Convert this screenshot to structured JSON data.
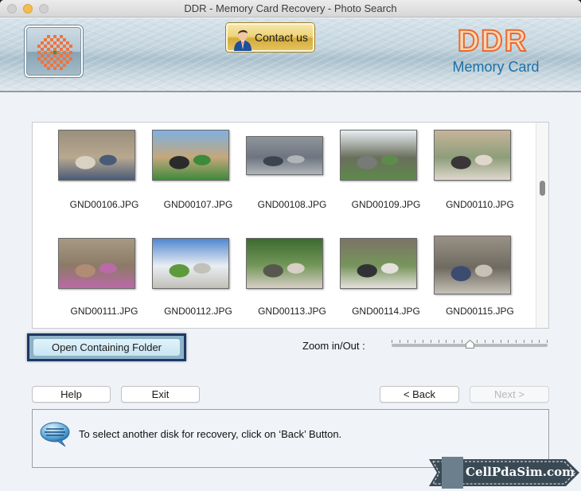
{
  "window": {
    "title": "DDR - Memory Card Recovery - Photo Search"
  },
  "header": {
    "logo_icon": "ddr-checker-logo-icon",
    "contact_label": "Contact us",
    "contact_icon": "person-icon",
    "brand_title": "DDR",
    "brand_subtitle": "Memory Card"
  },
  "gallery": {
    "items": [
      {
        "name": "GND00106.JPG",
        "colors": [
          "#9a8f7c",
          "#b8a88f",
          "#4a5b78",
          "#d9d2c2"
        ]
      },
      {
        "name": "GND00107.JPG",
        "colors": [
          "#7fb0e0",
          "#c5a77a",
          "#3d8a3b",
          "#2b2b2b"
        ]
      },
      {
        "name": "GND00108.JPG",
        "colors": [
          "#8f959b",
          "#6f7580",
          "#b0b5ba",
          "#3c4450"
        ]
      },
      {
        "name": "GND00109.JPG",
        "colors": [
          "#e8eef3",
          "#6a6e5c",
          "#5e8a4b",
          "#787a78"
        ]
      },
      {
        "name": "GND00110.JPG",
        "colors": [
          "#c6b49a",
          "#8d9e7a",
          "#e0d7cc",
          "#3a3536"
        ]
      },
      {
        "name": "GND00111.JPG",
        "colors": [
          "#a69a84",
          "#8c7a66",
          "#bb6aa8",
          "#b18c75"
        ]
      },
      {
        "name": "GND00112.JPG",
        "colors": [
          "#4f86d0",
          "#e9eef3",
          "#c2c0b8",
          "#5c9a3c"
        ]
      },
      {
        "name": "GND00113.JPG",
        "colors": [
          "#3c6a30",
          "#75985a",
          "#d8cfc6",
          "#58574f"
        ]
      },
      {
        "name": "GND00114.JPG",
        "colors": [
          "#7b7466",
          "#76955b",
          "#e4e1dc",
          "#303236"
        ]
      },
      {
        "name": "GND00115.JPG",
        "colors": [
          "#9a9186",
          "#6e6a60",
          "#c7c2b8",
          "#3b4c70"
        ]
      }
    ],
    "scroll_position": 0.4
  },
  "actions": {
    "open_folder_label": "Open Containing Folder",
    "zoom_label": "Zoom in/Out :",
    "zoom_value": 0.5,
    "zoom_ticks": 21,
    "help_label": "Help",
    "exit_label": "Exit",
    "back_label": "< Back",
    "next_label": "Next >"
  },
  "message": {
    "icon": "speech-bubble-icon",
    "text": "To select another disk for recovery, click on ‘Back’ Button."
  },
  "watermark": {
    "text": "CellPdaSim.com"
  }
}
